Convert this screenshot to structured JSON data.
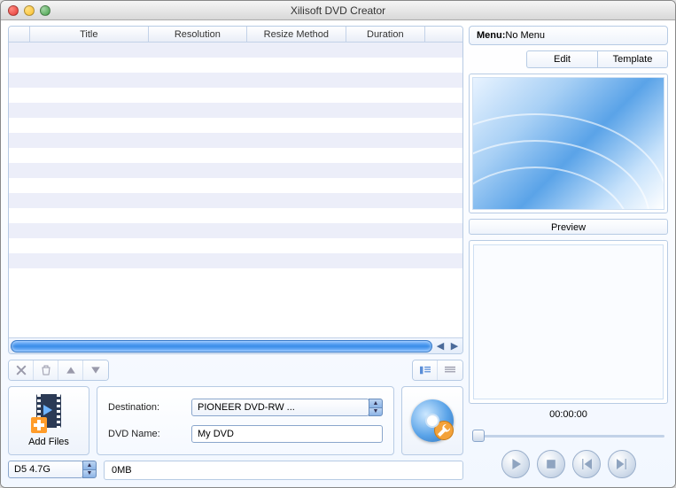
{
  "window": {
    "title": "Xilisoft DVD Creator"
  },
  "columns": {
    "title": "Title",
    "resolution": "Resolution",
    "resize": "Resize Method",
    "duration": "Duration"
  },
  "form": {
    "destination_label": "Destination:",
    "destination_value": "PIONEER DVD-RW  ...",
    "dvdname_label": "DVD Name:",
    "dvdname_value": "My DVD"
  },
  "addfiles_label": "Add Files",
  "disk": {
    "type": "D5 4.7G",
    "used": "0MB"
  },
  "menu": {
    "header_prefix": "Menu:",
    "header_value": "No Menu",
    "edit": "Edit",
    "template": "Template"
  },
  "preview": {
    "label": "Preview",
    "time": "00:00:00"
  }
}
